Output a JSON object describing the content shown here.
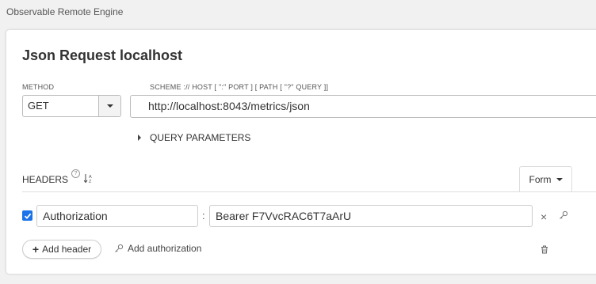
{
  "app": {
    "title": "Observable Remote Engine"
  },
  "request": {
    "title": "Json Request localhost",
    "method_label": "METHOD",
    "method": "GET",
    "url_label": "SCHEME :// HOST [ \":\" PORT ] [ PATH [ \"?\" QUERY ]]",
    "url": "http://localhost:8043/metrics/json",
    "query_parameters_label": "QUERY PARAMETERS"
  },
  "headers": {
    "label": "HEADERS",
    "help_glyph": "?",
    "sort_glyph": "↓A Z",
    "mode_label": "Form",
    "items": [
      {
        "enabled": true,
        "name": "Authorization",
        "value": "Bearer F7VvcRAC6T7aArU"
      }
    ],
    "separator": ":",
    "remove_glyph": "×",
    "add_header_label": "Add header",
    "add_authorization_label": "Add authorization"
  },
  "icons": {
    "help": "help-icon",
    "sort": "sort-alpha-icon",
    "remove": "close-icon",
    "key": "key-icon",
    "trash": "trash-icon",
    "plus": "plus-icon",
    "checkbox": "checkbox-checked-icon"
  },
  "colors": {
    "accent": "#1a73e8",
    "background": "#f1f1f1",
    "card": "#ffffff"
  }
}
